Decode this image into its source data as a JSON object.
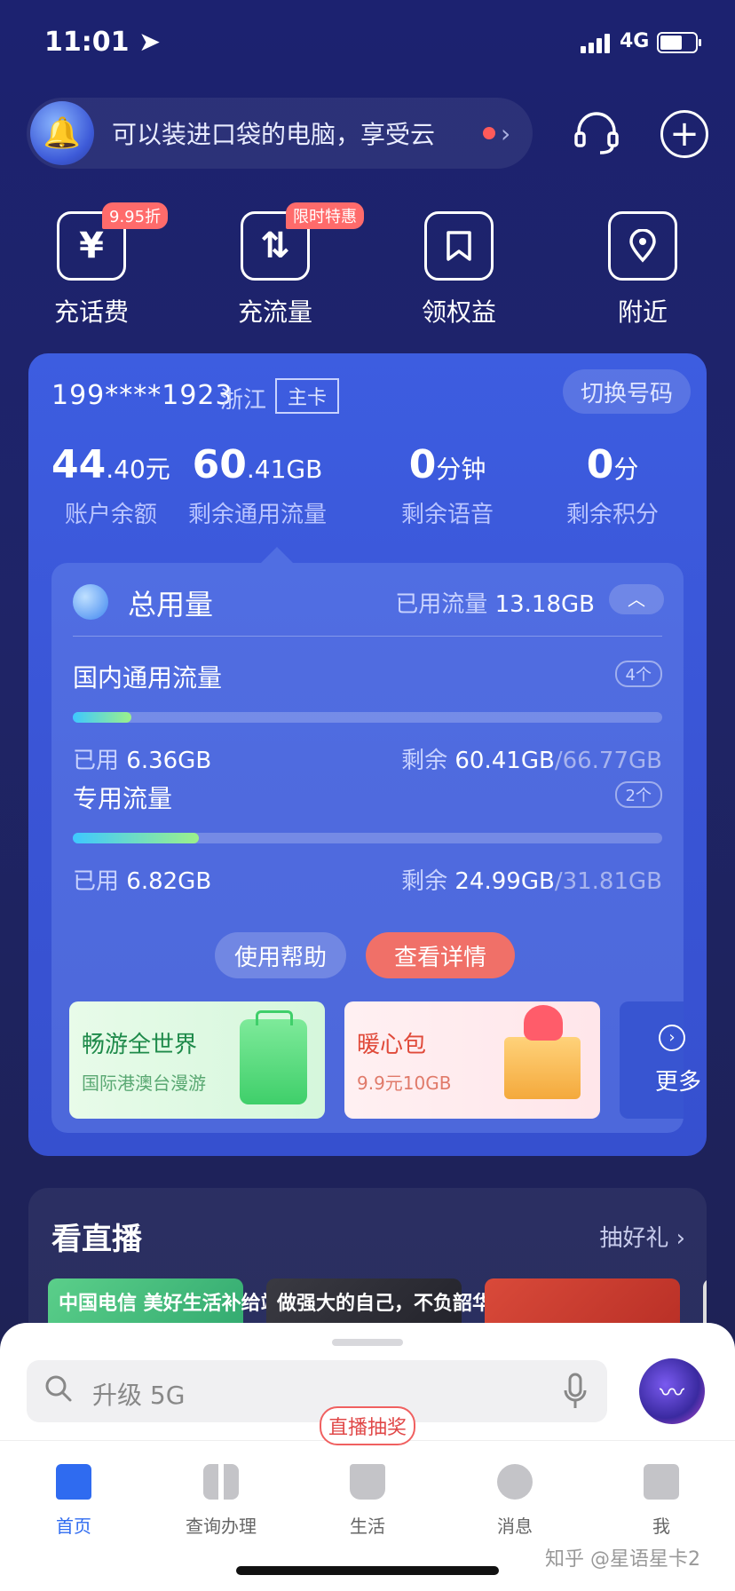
{
  "status": {
    "time": "11:01",
    "network": "4G"
  },
  "promo": {
    "text": "可以装进口袋的电脑，享受云"
  },
  "quick_actions": [
    {
      "label": "充话费",
      "badge": "9.95折",
      "icon": "yuan-icon"
    },
    {
      "label": "充流量",
      "badge": "限时特惠",
      "icon": "data-icon"
    },
    {
      "label": "领权益",
      "badge": "",
      "icon": "bookmark-icon"
    },
    {
      "label": "附近",
      "badge": "",
      "icon": "location-icon"
    }
  ],
  "account": {
    "phone": "199****1923",
    "region": "浙江",
    "card_type": "主卡",
    "switch_label": "切换号码",
    "stats": [
      {
        "big": "44",
        "small": ".40元",
        "label": "账户余额"
      },
      {
        "big": "60",
        "small": ".41GB",
        "label": "剩余通用流量"
      },
      {
        "big": "0",
        "small": "分钟",
        "label": "剩余语音"
      },
      {
        "big": "0",
        "small": "分",
        "label": "剩余积分"
      }
    ]
  },
  "usage": {
    "title": "总用量",
    "used_label": "已用流量",
    "used_value": "13.18GB",
    "sections": [
      {
        "name": "国内通用流量",
        "count": "4个",
        "used_label": "已用",
        "used": "6.36GB",
        "remain_label": "剩余",
        "remain": "60.41GB",
        "total": "/66.77GB",
        "fraction": 0.1
      },
      {
        "name": "专用流量",
        "count": "2个",
        "used_label": "已用",
        "used": "6.82GB",
        "remain_label": "剩余",
        "remain": "24.99GB",
        "total": "/31.81GB",
        "fraction": 0.214
      }
    ],
    "help_button": "使用帮助",
    "detail_button": "查看详情"
  },
  "promos": [
    {
      "title": "畅游全世界",
      "subtitle": "国际港澳台漫游"
    },
    {
      "title": "暖心包",
      "subtitle": "9.9元10GB"
    }
  ],
  "more_label": "更多",
  "live": {
    "title": "看直播",
    "right": "抽好礼",
    "thumbs": [
      "中国电信 美好生活补给站",
      "做强大的自己，不负韶华",
      "",
      ""
    ]
  },
  "search": {
    "placeholder": "升级 5G"
  },
  "live_badge": "直播抽奖",
  "tabs": [
    {
      "label": "首页",
      "active": true
    },
    {
      "label": "查询办理",
      "active": false
    },
    {
      "label": "生活",
      "active": false
    },
    {
      "label": "消息",
      "active": false
    },
    {
      "label": "我",
      "active": false
    }
  ],
  "watermark": "知乎 @星语星卡2",
  "colors": {
    "accent": "#2f6bf0",
    "card": "#3d5de0",
    "detail_button": "#f07068"
  }
}
